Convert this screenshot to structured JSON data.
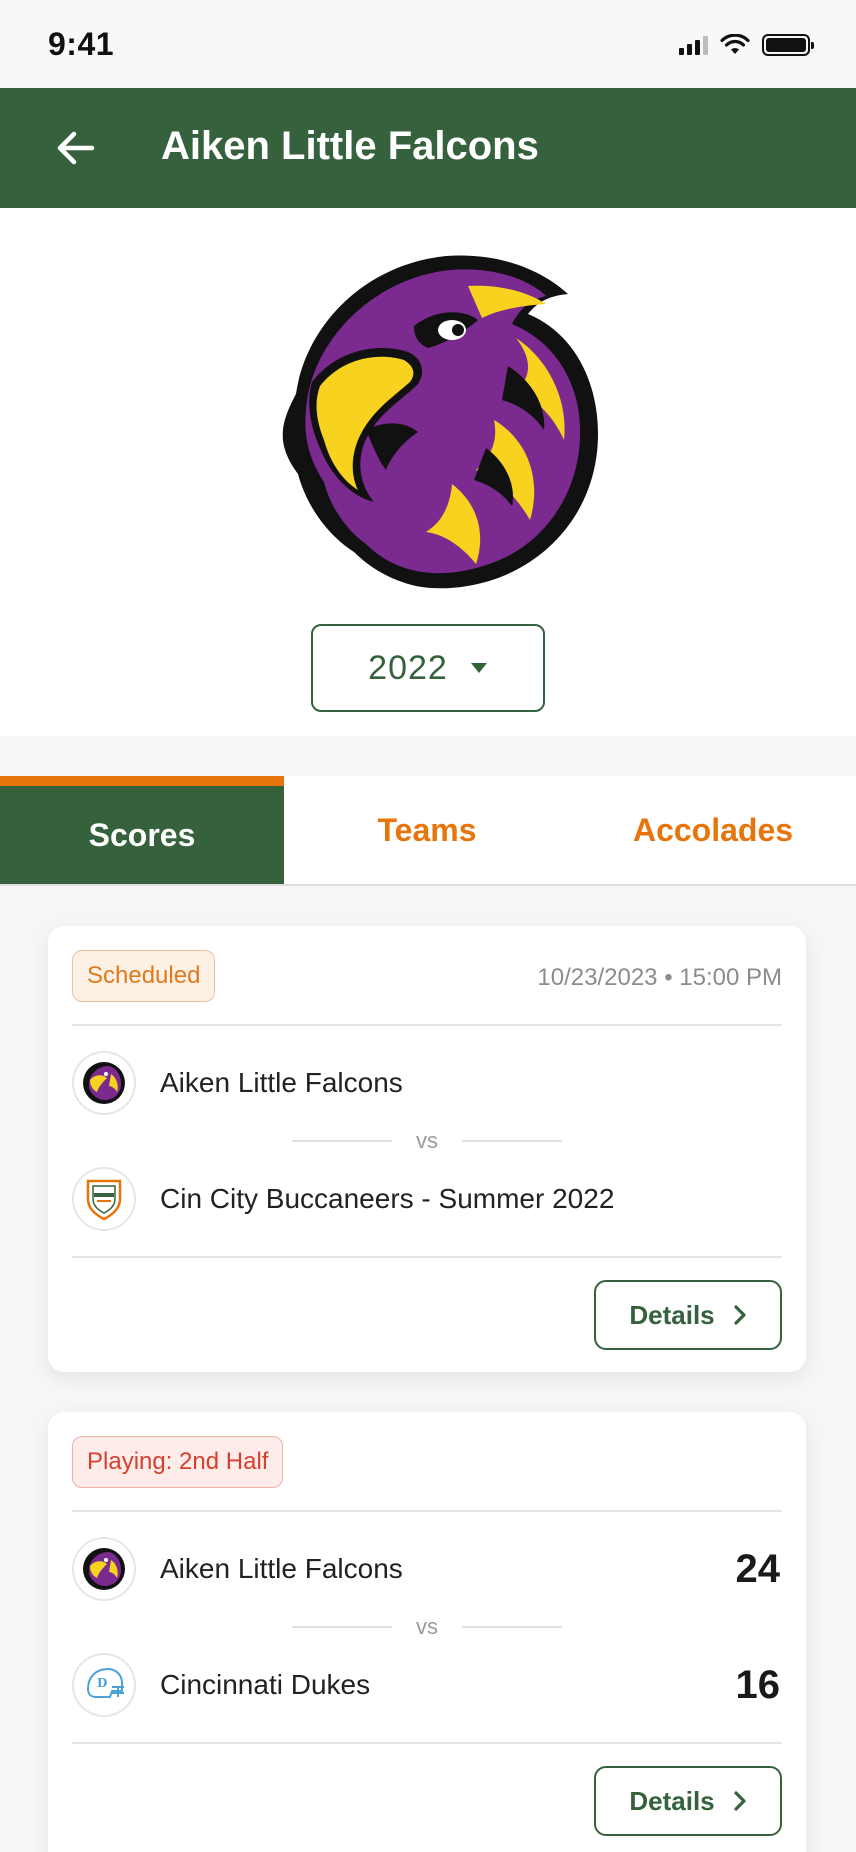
{
  "status_bar": {
    "time": "9:41"
  },
  "header": {
    "title": "Aiken Little Falcons",
    "back_icon": "arrow-left-icon"
  },
  "hero": {
    "logo": "falcon-mascot-logo",
    "year": "2022"
  },
  "tabs": [
    {
      "label": "Scores",
      "active": true
    },
    {
      "label": "Teams",
      "active": false
    },
    {
      "label": "Accolades",
      "active": false
    }
  ],
  "games": [
    {
      "status": "Scheduled",
      "datetime": "10/23/2023 • 15:00 PM",
      "home": {
        "name": "Aiken Little Falcons",
        "score": ""
      },
      "vs": "vs",
      "away": {
        "name": "Cin City Buccaneers - Summer 2022",
        "score": ""
      },
      "details_label": "Details"
    },
    {
      "status": "Playing: 2nd Half",
      "datetime": "",
      "home": {
        "name": "Aiken Little Falcons",
        "score": "24"
      },
      "vs": "vs",
      "away": {
        "name": "Cincinnati Dukes",
        "score": "16"
      },
      "details_label": "Details"
    }
  ],
  "colors": {
    "primary_green": "#35623d",
    "accent_orange": "#e8740c",
    "falcon_purple": "#7b2a8f",
    "falcon_yellow": "#f7d21e",
    "playing_red": "#d6402e"
  }
}
